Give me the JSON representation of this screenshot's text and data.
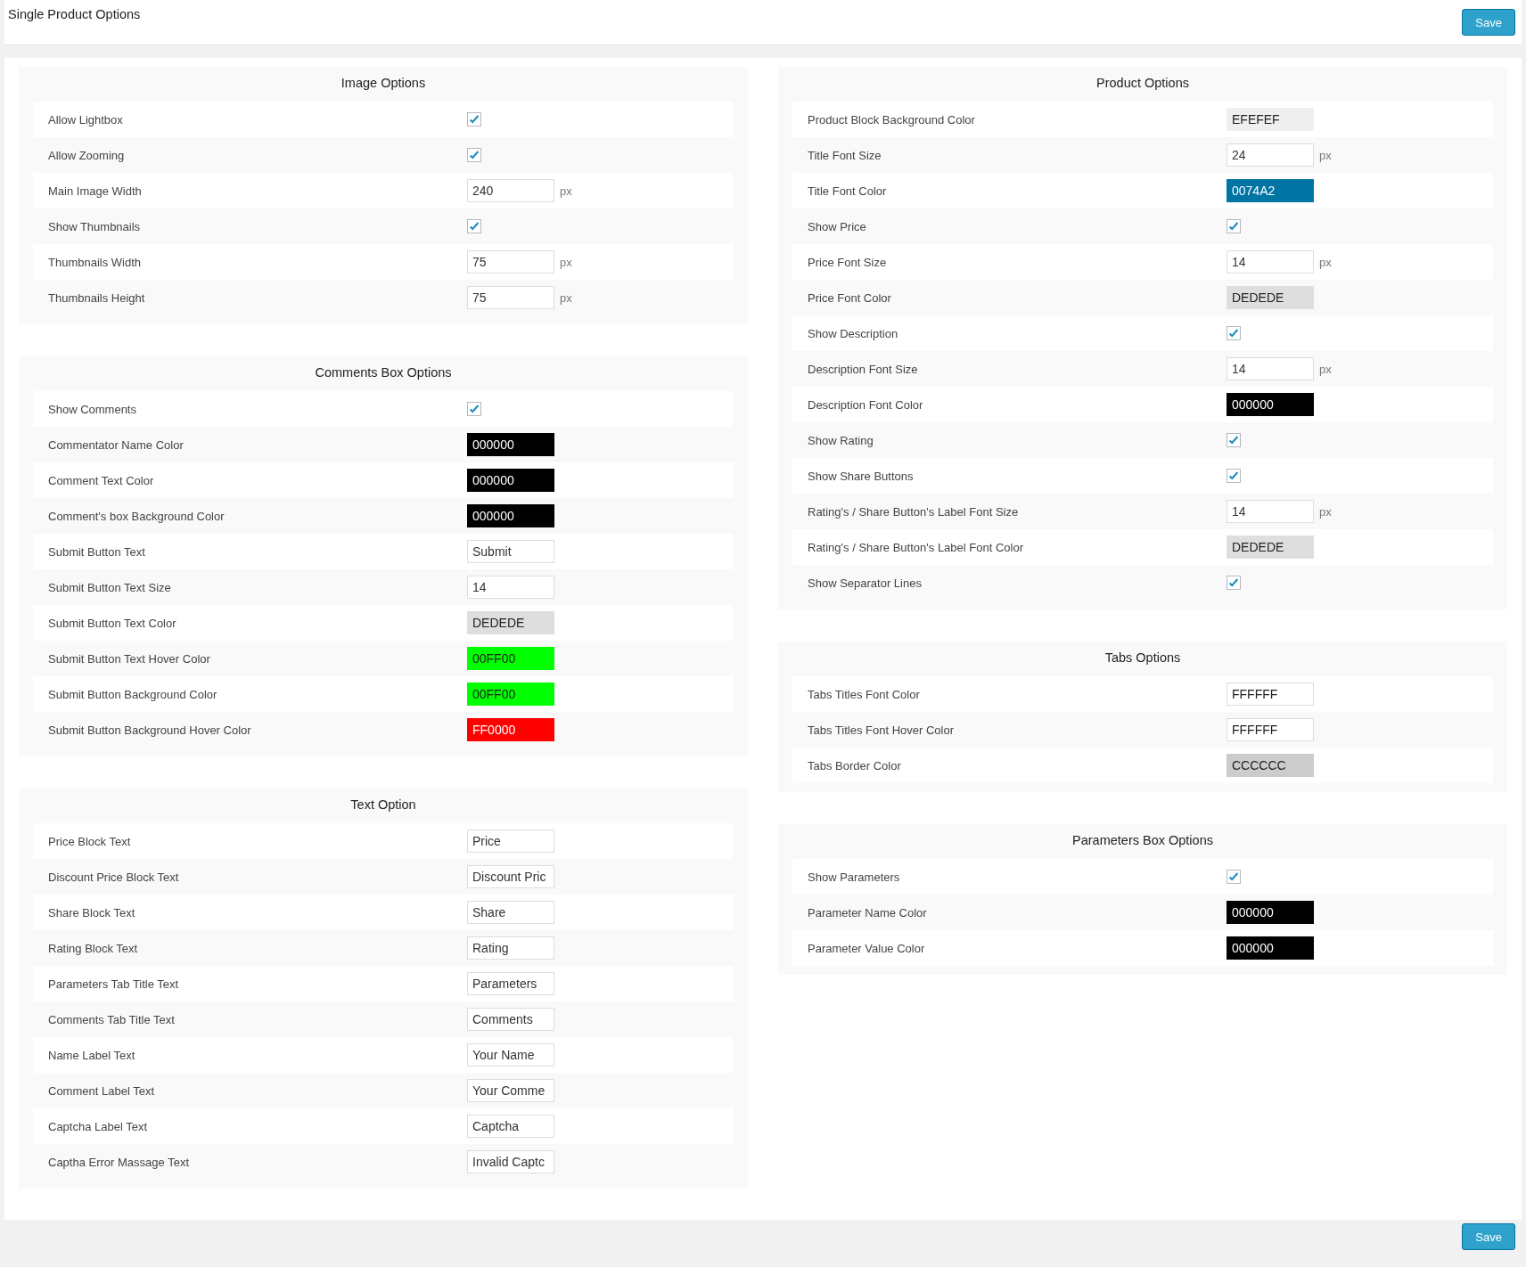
{
  "header": {
    "title": "Single Product Options",
    "save_button": "Save"
  },
  "columns": [
    [
      {
        "title": "Image Options",
        "rows": [
          {
            "kind": "checkbox",
            "label": "Allow Lightbox",
            "checked": true
          },
          {
            "kind": "checkbox",
            "label": "Allow Zooming",
            "checked": true
          },
          {
            "kind": "number",
            "label": "Main Image Width",
            "value": "240",
            "unit": "px"
          },
          {
            "kind": "checkbox",
            "label": "Show Thumbnails",
            "checked": true
          },
          {
            "kind": "number",
            "label": "Thumbnails Width",
            "value": "75",
            "unit": "px"
          },
          {
            "kind": "number",
            "label": "Thumbnails Height",
            "value": "75",
            "unit": "px"
          }
        ]
      },
      {
        "title": "Comments Box Options",
        "rows": [
          {
            "kind": "checkbox",
            "label": "Show Comments",
            "checked": true
          },
          {
            "kind": "color",
            "label": "Commentator Name Color",
            "value": "000000",
            "color": "#000000"
          },
          {
            "kind": "color",
            "label": "Comment Text Color",
            "value": "000000",
            "color": "#000000"
          },
          {
            "kind": "color",
            "label": "Comment's box Background Color",
            "value": "000000",
            "color": "#000000"
          },
          {
            "kind": "text",
            "label": "Submit Button Text",
            "value": "Submit"
          },
          {
            "kind": "text",
            "label": "Submit Button Text Size",
            "value": "14"
          },
          {
            "kind": "color",
            "label": "Submit Button Text Color",
            "value": "DEDEDE",
            "color": "#dedede"
          },
          {
            "kind": "color",
            "label": "Submit Button Text Hover Color",
            "value": "00FF00",
            "color": "#00ff00"
          },
          {
            "kind": "color",
            "label": "Submit Button Background Color",
            "value": "00FF00",
            "color": "#00ff00"
          },
          {
            "kind": "color",
            "label": "Submit Button Background Hover Color",
            "value": "FF0000",
            "color": "#ff0000"
          }
        ]
      },
      {
        "title": "Text Option",
        "rows": [
          {
            "kind": "text",
            "label": "Price Block Text",
            "value": "Price"
          },
          {
            "kind": "text",
            "label": "Discount Price Block Text",
            "value": "Discount Pric"
          },
          {
            "kind": "text",
            "label": "Share Block Text",
            "value": "Share"
          },
          {
            "kind": "text",
            "label": "Rating Block Text",
            "value": "Rating"
          },
          {
            "kind": "text",
            "label": "Parameters Tab Title Text",
            "value": "Parameters"
          },
          {
            "kind": "text",
            "label": "Comments Tab Title Text",
            "value": "Comments"
          },
          {
            "kind": "text",
            "label": "Name Label Text",
            "value": "Your Name"
          },
          {
            "kind": "text",
            "label": "Comment Label Text",
            "value": "Your Comme"
          },
          {
            "kind": "text",
            "label": "Captcha Label Text",
            "value": "Captcha"
          },
          {
            "kind": "text",
            "label": "Captha Error Massage Text",
            "value": "Invalid Captc"
          }
        ]
      }
    ],
    [
      {
        "title": "Product Options",
        "rows": [
          {
            "kind": "color",
            "label": "Product Block Background Color",
            "value": "EFEFEF",
            "color": "#efefef"
          },
          {
            "kind": "number",
            "label": "Title Font Size",
            "value": "24",
            "unit": "px"
          },
          {
            "kind": "color",
            "label": "Title Font Color",
            "value": "0074A2",
            "color": "#0074a2"
          },
          {
            "kind": "checkbox",
            "label": "Show Price",
            "checked": true
          },
          {
            "kind": "number",
            "label": "Price Font Size",
            "value": "14",
            "unit": "px"
          },
          {
            "kind": "color",
            "label": "Price Font Color",
            "value": "DEDEDE",
            "color": "#dedede"
          },
          {
            "kind": "checkbox",
            "label": "Show Description",
            "checked": true
          },
          {
            "kind": "number",
            "label": "Description Font Size",
            "value": "14",
            "unit": "px"
          },
          {
            "kind": "color",
            "label": "Description Font Color",
            "value": "000000",
            "color": "#000000"
          },
          {
            "kind": "checkbox",
            "label": "Show Rating",
            "checked": true
          },
          {
            "kind": "checkbox",
            "label": "Show Share Buttons",
            "checked": true
          },
          {
            "kind": "number",
            "label": "Rating's / Share Button's Label Font Size",
            "value": "14",
            "unit": "px"
          },
          {
            "kind": "color",
            "label": "Rating's / Share Button's Label Font Color",
            "value": "DEDEDE",
            "color": "#dedede"
          },
          {
            "kind": "checkbox",
            "label": "Show Separator Lines",
            "checked": true
          }
        ]
      },
      {
        "title": "Tabs Options",
        "rows": [
          {
            "kind": "color",
            "label": "Tabs Titles Font Color",
            "value": "FFFFFF",
            "color": "#ffffff"
          },
          {
            "kind": "color",
            "label": "Tabs Titles Font Hover Color",
            "value": "FFFFFF",
            "color": "#ffffff"
          },
          {
            "kind": "color",
            "label": "Tabs Border Color",
            "value": "CCCCCC",
            "color": "#cccccc"
          }
        ]
      },
      {
        "title": "Parameters Box Options",
        "rows": [
          {
            "kind": "checkbox",
            "label": "Show Parameters",
            "checked": true
          },
          {
            "kind": "color",
            "label": "Parameter Name Color",
            "value": "000000",
            "color": "#000000"
          },
          {
            "kind": "color",
            "label": "Parameter Value Color",
            "value": "000000",
            "color": "#000000"
          }
        ]
      }
    ]
  ],
  "footer": {
    "save_button": "Save"
  }
}
